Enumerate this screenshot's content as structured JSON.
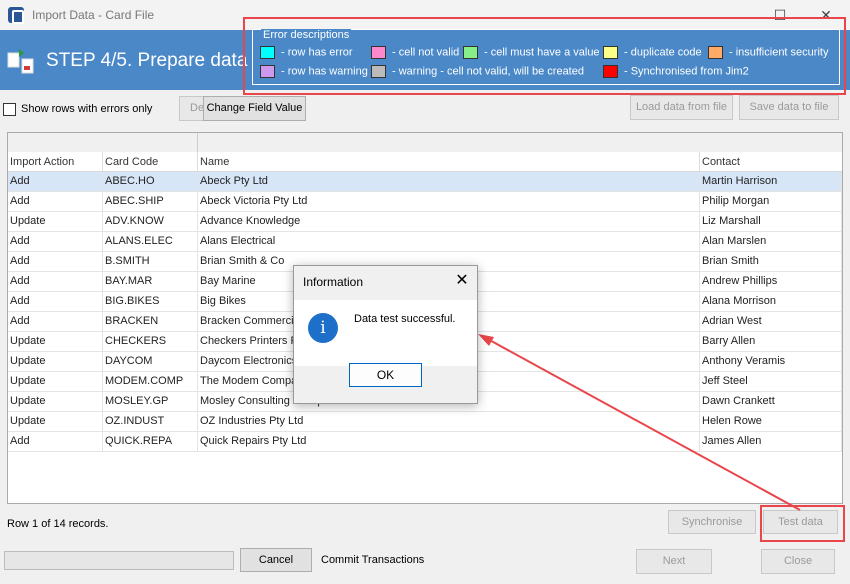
{
  "window": {
    "title": "Import Data - Card File",
    "minimize": "—",
    "maximize": "☐",
    "close": "✕"
  },
  "step": {
    "title": "STEP 4/5. Prepare data"
  },
  "legend": {
    "title": "Error descriptions",
    "items": [
      {
        "color": "#00ffff",
        "label": "- row has error"
      },
      {
        "color": "#ff88cc",
        "label": "- cell not valid"
      },
      {
        "color": "#88ee88",
        "label": "- cell must have a value"
      },
      {
        "color": "#ffff88",
        "label": "- duplicate code"
      },
      {
        "color": "#ffaa66",
        "label": "- insufficient security"
      },
      {
        "color": "#cc99ee",
        "label": "- row has warning"
      },
      {
        "color": "#bbbbbb",
        "label": "- warning - cell not valid, will be created"
      },
      {
        "color": "#ff0000",
        "label": "- Synchronised from Jim2"
      }
    ]
  },
  "toolbar": {
    "show_errors_label": "Show rows with errors only",
    "de_button": "De",
    "change_field_button": "Change Field Value",
    "load_button": "Load data from file",
    "save_button": "Save data to file"
  },
  "grid": {
    "columns": [
      "Import Action",
      "Card Code",
      "Name",
      "Contact"
    ],
    "rows": [
      [
        "Add",
        "ABEC.HO",
        "Abeck Pty Ltd",
        "Martin Harrison"
      ],
      [
        "Add",
        "ABEC.SHIP",
        "Abeck Victoria Pty Ltd",
        "Philip Morgan"
      ],
      [
        "Update",
        "ADV.KNOW",
        "Advance Knowledge",
        "Liz Marshall"
      ],
      [
        "Add",
        "ALANS.ELEC",
        "Alans Electrical",
        "Alan Marslen"
      ],
      [
        "Add",
        "B.SMITH",
        "Brian Smith & Co",
        "Brian Smith"
      ],
      [
        "Add",
        "BAY.MAR",
        "Bay Marine",
        "Andrew Phillips"
      ],
      [
        "Add",
        "BIG.BIKES",
        "Big Bikes",
        "Alana Morrison"
      ],
      [
        "Add",
        "BRACKEN",
        "Bracken Commercia",
        "Adrian West"
      ],
      [
        "Update",
        "CHECKERS",
        "Checkers Printers P",
        "Barry Allen"
      ],
      [
        "Update",
        "DAYCOM",
        "Daycom Electronics",
        "Anthony Veramis"
      ],
      [
        "Update",
        "MODEM.COMP",
        "The Modem Compa",
        "Jeff Steel"
      ],
      [
        "Update",
        "MOSLEY.GP",
        "Mosley Consulting Group",
        "Dawn Crankett"
      ],
      [
        "Update",
        "OZ.INDUST",
        "OZ Industries Pty Ltd",
        "Helen Rowe"
      ],
      [
        "Add",
        "QUICK.REPA",
        "Quick Repairs Pty Ltd",
        "James Allen"
      ]
    ]
  },
  "status": {
    "text": "Row 1 of 14 records."
  },
  "actions": {
    "synchronise": "Synchronise",
    "test_data": "Test data",
    "cancel": "Cancel",
    "commit": "Commit Transactions",
    "next": "Next",
    "close": "Close"
  },
  "dialog": {
    "title": "Information",
    "close": "✕",
    "icon": "i",
    "message": "Data test successful.",
    "ok": "OK"
  },
  "colors": {
    "header_blue": "#4a88c8",
    "annotation_red": "#e8464a"
  }
}
